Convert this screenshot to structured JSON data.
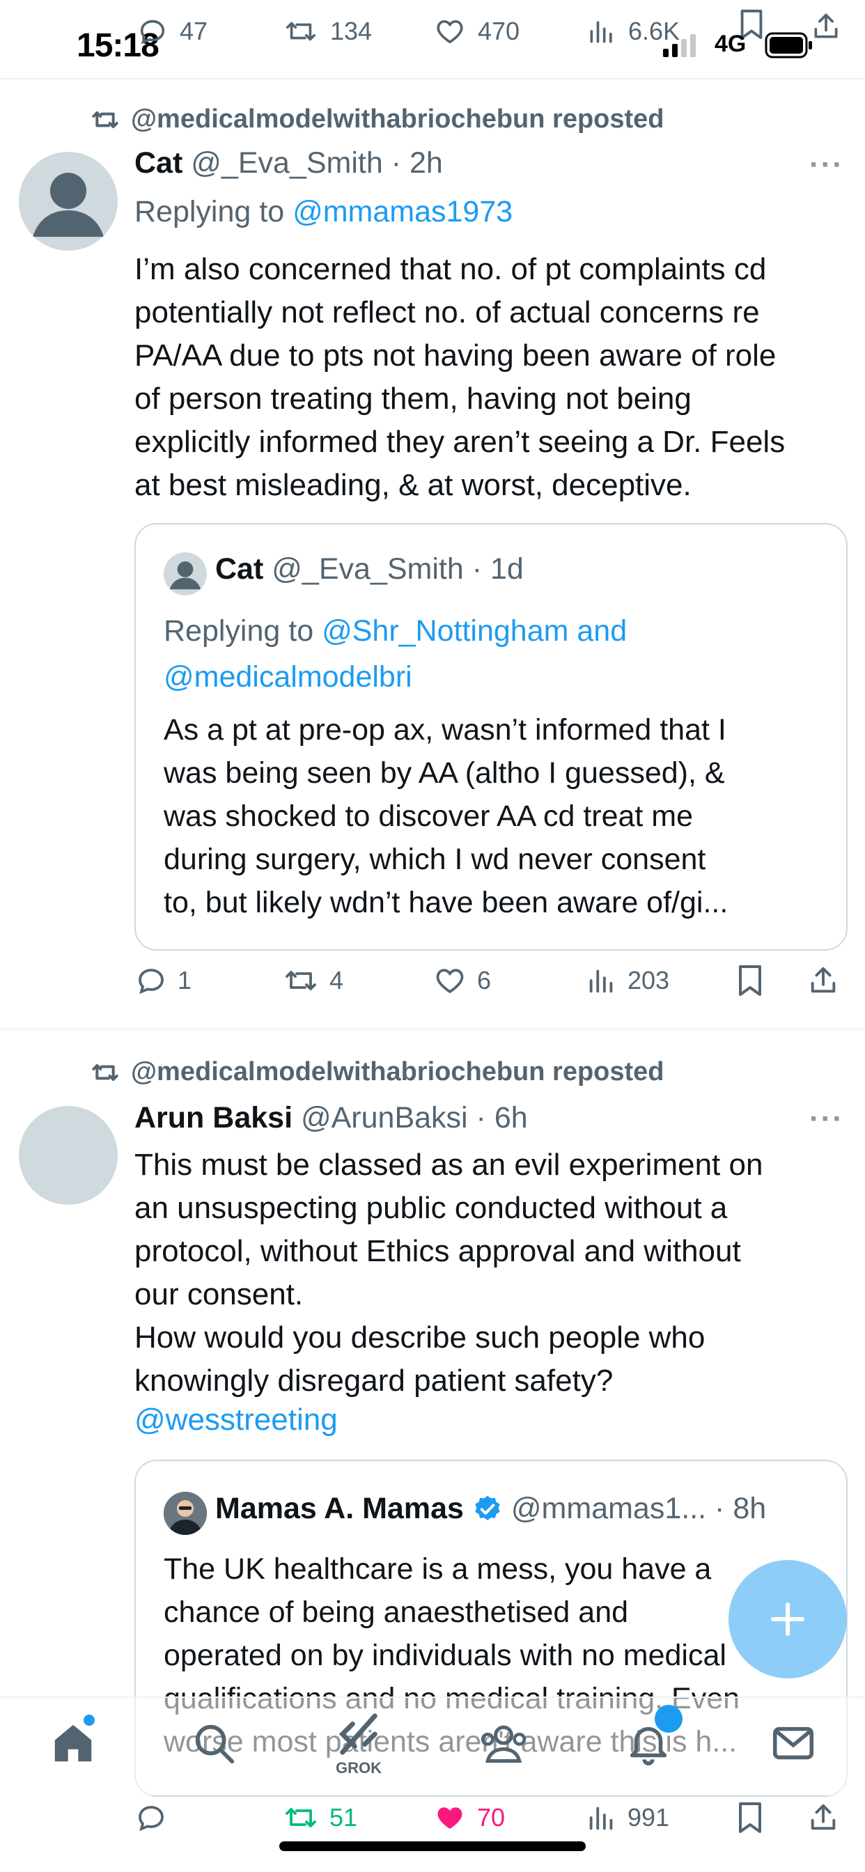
{
  "status": {
    "time": "15:18",
    "network": "4G"
  },
  "top_actions": {
    "replies": "47",
    "reposts": "134",
    "likes": "470",
    "views": "6.6K"
  },
  "posts": [
    {
      "repost_by": "@medicalmodelwithabriochebun reposted",
      "name": "Cat",
      "handle": "@_Eva_Smith",
      "time": "2h",
      "replying_label": "Replying to ",
      "replying_to": "@mmamas1973",
      "text": "I’m also concerned that no. of pt complaints cd\npotentially not reflect no. of actual concerns re\nPA/AA due to pts not having been aware of role\nof person treating them, having not being\nexplicitly informed they aren’t seeing a Dr. Feels\nat best misleading, & at worst, deceptive.",
      "quote": {
        "name": "Cat",
        "handle": "@_Eva_Smith",
        "time": "1d",
        "replying_label": "Replying to ",
        "replying_to_1": "@Shr_Nottingham and",
        "replying_to_2": "@medicalmodelbri",
        "text": "As a pt at pre-op ax, wasn’t informed that I\nwas being seen by AA (altho I guessed), &\nwas shocked to discover AA cd treat me\nduring surgery, which I wd never consent\nto, but likely wdn’t have been aware of/gi..."
      },
      "stats": {
        "replies": "1",
        "reposts": "4",
        "likes": "6",
        "views": "203"
      }
    },
    {
      "repost_by": "@medicalmodelwithabriochebun reposted",
      "name": "Arun Baksi",
      "handle": "@ArunBaksi",
      "time": "6h",
      "text": "This must be classed as an evil experiment on\nan unsuspecting public conducted without a\nprotocol, without Ethics approval and without\nour consent.\nHow would you describe such people who\nknowingly disregard patient safety?",
      "mention": "@wesstreeting",
      "quote": {
        "name": "Mamas A. Mamas",
        "handle": "@mmamas1...",
        "time": "8h",
        "text": "The UK healthcare is a mess, you have a\nchance of being anaesthetised and\noperated on by individuals with no medical\nqualifications and no medical training. Even\nworse most patients aren't aware this is h..."
      },
      "stats": {
        "replies": "",
        "reposts": "51",
        "likes": "70",
        "views": "991"
      }
    }
  ],
  "nav": {
    "grok_label": "GROK",
    "notification_badge": ""
  },
  "colors": {
    "accent": "#1d9bf0",
    "like": "#f91880",
    "repost": "#00ba7c",
    "fab": "#8ecdf8"
  }
}
